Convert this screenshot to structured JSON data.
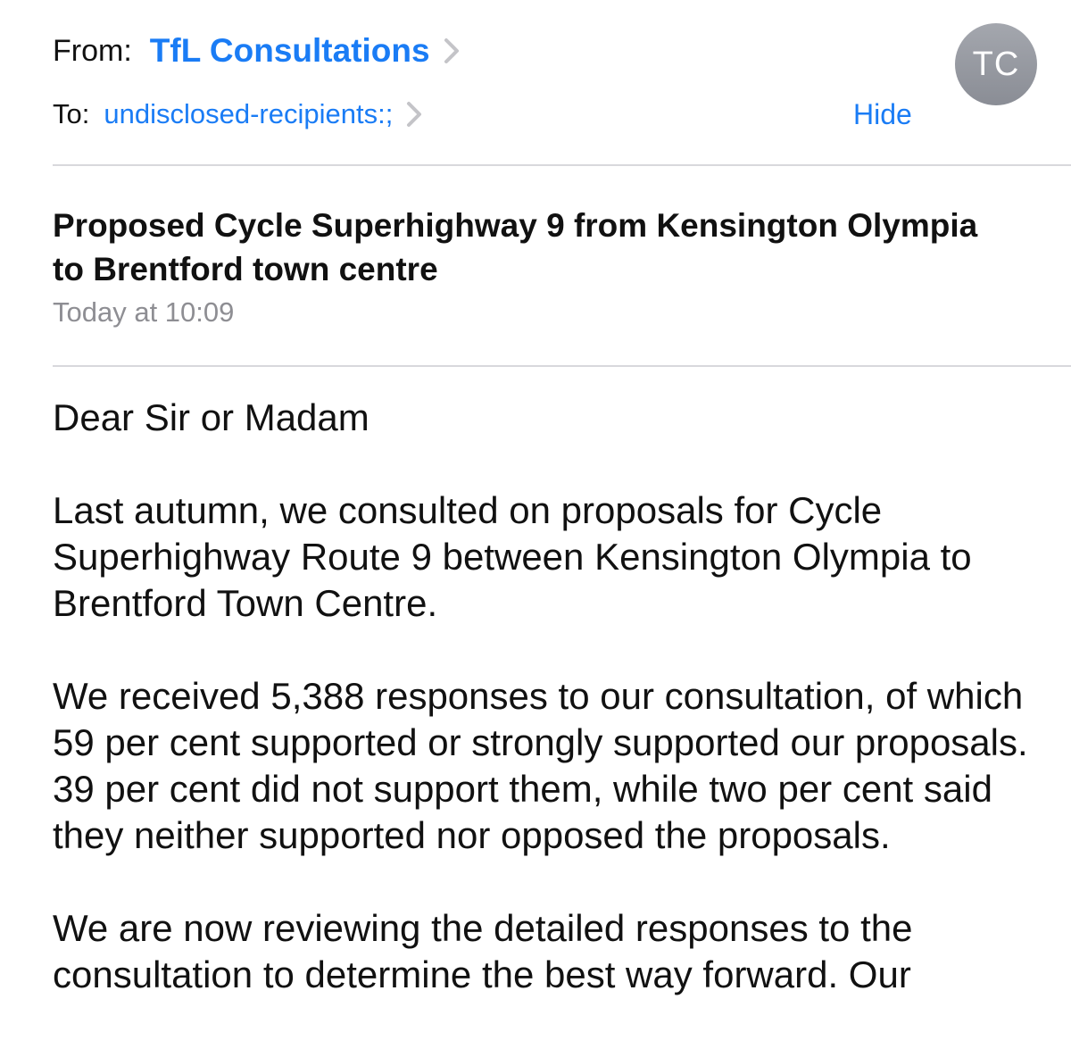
{
  "header": {
    "from_label": "From:",
    "from_name": "TfL Consultations",
    "to_label": "To:",
    "to_value": "undisclosed-recipients:;",
    "hide_label": "Hide",
    "avatar_initials": "TC"
  },
  "message": {
    "subject": "Proposed Cycle Superhighway 9 from Kensington Olympia to Brentford town centre",
    "timestamp": "Today at 10:09",
    "paragraphs": [
      "Dear Sir or Madam",
      "Last autumn, we consulted on proposals for Cycle Superhighway Route 9 between Kensington Olympia to Brentford Town Centre.",
      "We received 5,388 responses to our consultation, of which 59 per cent supported or strongly supported our proposals. 39 per cent did not support them, while two per cent said they neither supported nor opposed the proposals.",
      "We are now reviewing the detailed responses to the consultation to determine the best way forward. Our"
    ]
  },
  "colors": {
    "link_blue": "#1a7cf5",
    "muted_gray": "#8e8e93",
    "avatar_gray": "#8e9097",
    "divider": "#d8d8dc"
  },
  "icons": [
    "chevron-right-icon"
  ]
}
